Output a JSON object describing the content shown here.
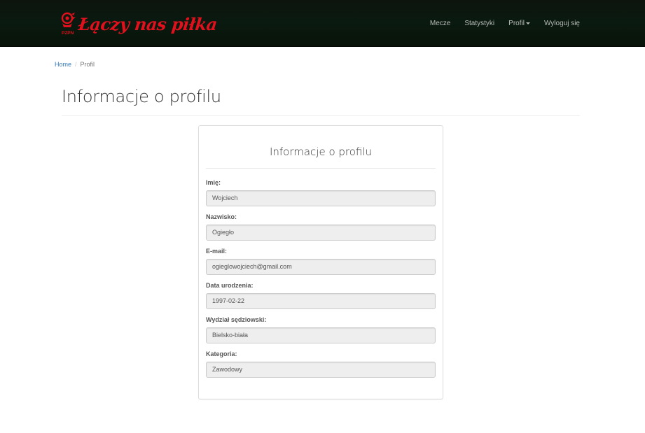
{
  "header": {
    "brand_text": "Łączy nas piłka",
    "emblem_text": "PZPN",
    "nav": [
      {
        "label": "Mecze"
      },
      {
        "label": "Statystyki"
      },
      {
        "label": "Profil"
      },
      {
        "label": "Wyloguj się"
      }
    ]
  },
  "breadcrumb": {
    "home": "Home",
    "separator": "/",
    "current": "Profil"
  },
  "page": {
    "title": "Informacje o profilu"
  },
  "panel": {
    "title": "Informacje o profilu",
    "fields": [
      {
        "label": "Imię:",
        "value": "Wojciech"
      },
      {
        "label": "Nazwisko:",
        "value": "Ogiegło"
      },
      {
        "label": "E-mail:",
        "value": "ogieglowojciech@gmail.com"
      },
      {
        "label": "Data urodzenia:",
        "value": "1997-02-22"
      },
      {
        "label": "Wydział sędziowski:",
        "value": "Bielsko-biała"
      },
      {
        "label": "Kategoria:",
        "value": "Zawodowy"
      }
    ]
  },
  "colors": {
    "navbar_bg": "#0a1a10",
    "brand_red": "#e0111d",
    "link_blue": "#337ab7",
    "readonly_input_bg": "#eeeeee"
  },
  "icons": {
    "brand_emblem": "pzpn-eagle-emblem-icon",
    "dropdown": "caret-down-icon"
  }
}
